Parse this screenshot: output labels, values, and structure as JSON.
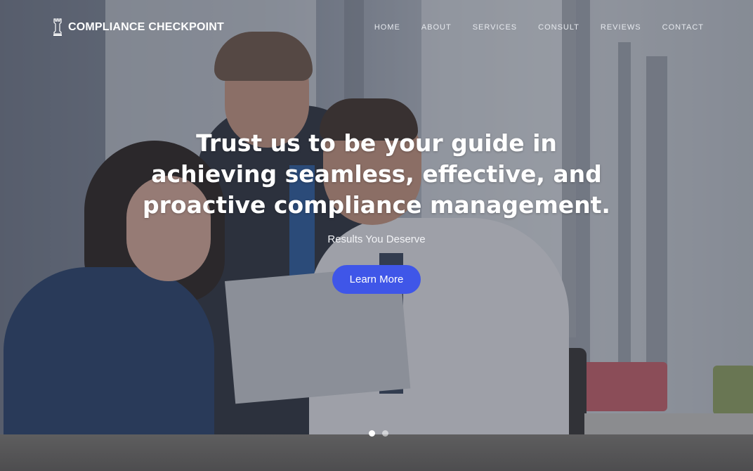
{
  "brand": {
    "name": "COMPLIANCE CHECKPOINT",
    "icon": "chess-rook-icon"
  },
  "nav": {
    "items": [
      "HOME",
      "ABOUT",
      "SERVICES",
      "CONSULT",
      "REVIEWS",
      "CONTACT"
    ]
  },
  "hero": {
    "headline": "Trust us to be your guide in achieving seamless, effective, and proactive compliance management.",
    "subheadline": "Results You Deserve",
    "cta_label": "Learn More",
    "slide_count": 2,
    "active_slide": 1
  },
  "colors": {
    "accent": "#3f56e8",
    "text": "#ffffff"
  }
}
